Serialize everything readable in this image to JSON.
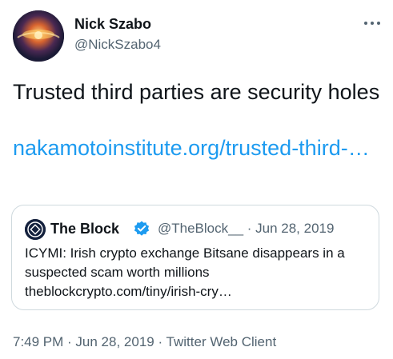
{
  "author": {
    "name": "Nick Szabo",
    "handle": "@NickSzabo4",
    "avatar_icon": "profile-photo"
  },
  "more_icon": "more-dots-icon",
  "tweet": {
    "text": "Trusted third parties are security holes",
    "link_text": "nakamotoinstitute.org/trusted-third-…"
  },
  "quoted": {
    "name": "The Block",
    "verified_icon": "verified-badge-icon",
    "meta": "@TheBlock__ · Jun 28, 2019",
    "text": "ICYMI: Irish crypto exchange Bitsane disappears in a suspected scam worth millions",
    "link_text": "theblockcrypto.com/tiny/irish-cry…"
  },
  "footer": {
    "time": "7:49 PM",
    "sep1": " · ",
    "date": "Jun 28, 2019",
    "sep2": " · ",
    "client": "Twitter Web Client"
  },
  "colors": {
    "link": "#1d9bf0",
    "secondary_text": "#536471",
    "border": "#cfd9de",
    "verified": "#1d9bf0"
  }
}
